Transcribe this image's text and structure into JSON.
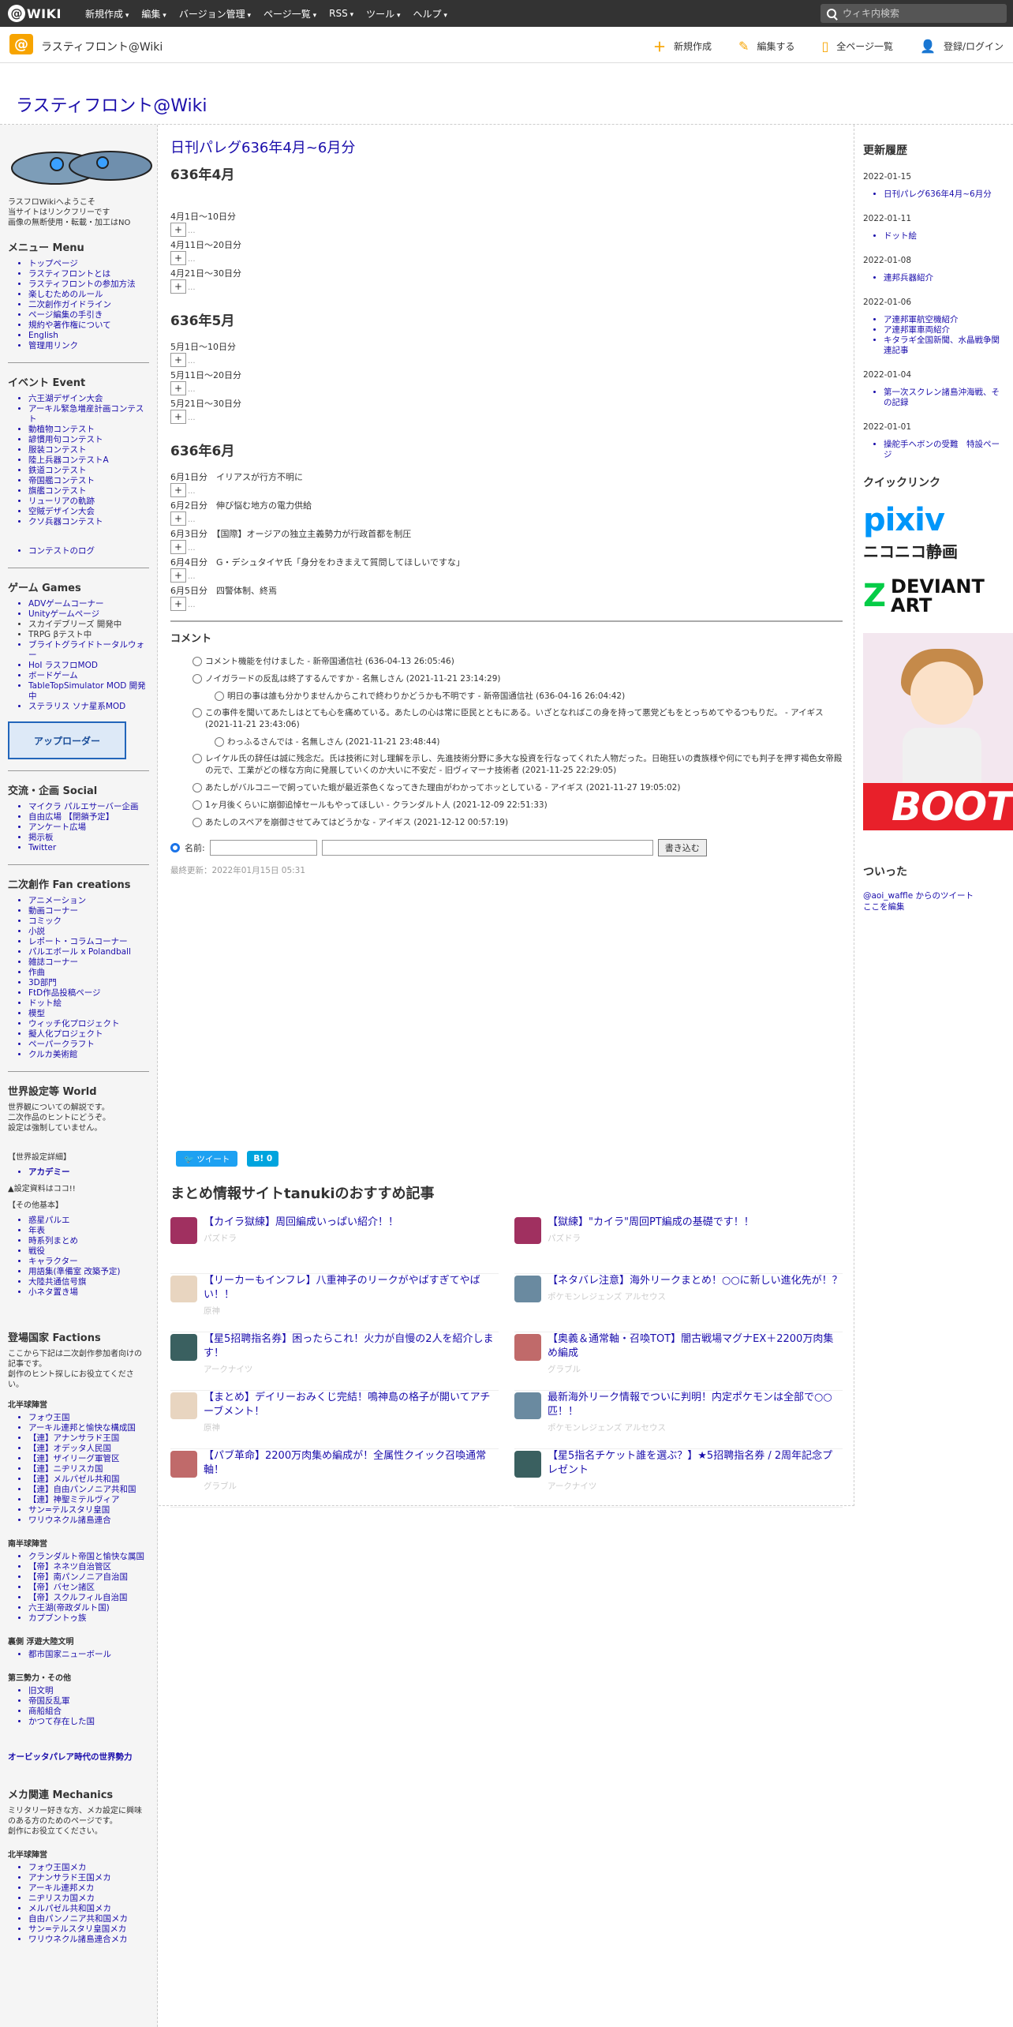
{
  "topbar": {
    "logo": "WIKI",
    "nav": [
      "新規作成",
      "編集",
      "バージョン管理",
      "ページ一覧",
      "RSS",
      "ツール",
      "ヘルプ"
    ],
    "search_placeholder": "ウィキ内検索"
  },
  "header": {
    "site_name": "ラスティフロント@Wiki",
    "actions": [
      "新規作成",
      "編集する",
      "全ページ一覧",
      "登録/ログイン"
    ],
    "page_title": "ラスティフロント@Wiki"
  },
  "left": {
    "intro": [
      "ラスフロWikiへようこそ",
      "当サイトはリンクフリーです",
      "画像の無断使用・転載・加工はNO"
    ],
    "menu_title": "メニュー Menu",
    "menu": [
      "トップページ",
      "ラスティフロントとは",
      "ラスティフロントの参加方法",
      "楽しむためのルール",
      "二次創作ガイドライン",
      "ページ編集の手引き",
      "規約や著作権について",
      "English",
      "管理用リンク"
    ],
    "event_title": "イベント Event",
    "events": [
      "六王湖デザイン大会",
      "アーキル緊急増産計画コンテスト",
      "動植物コンテスト",
      "諺慣用句コンテスト",
      "服装コンテスト",
      "陸上兵器コンテストA",
      "鉄道コンテスト",
      "帝国艦コンテスト",
      "旗艦コンテスト",
      "リューリアの軌跡",
      "空賊デザイン大会",
      "クソ兵器コンテスト"
    ],
    "contest_log": "コンテストのログ",
    "game_title": "ゲーム Games",
    "games": [
      "ADVゲームコーナー",
      "Unityゲームページ",
      "スカイデブリーズ 開発中",
      "TRPG βテスト中",
      "ブライトグライドトータルウォー",
      "HoI ラスフロMOD",
      "ボードゲーム",
      "TableTopSimulator MOD 開発中",
      "ステラリス ソナ星系MOD"
    ],
    "banner": "アップローダー",
    "social_title": "交流・企画 Social",
    "social": [
      "マイクラ パルエサーバー企画",
      "自由広場 【閉鎖予定】",
      "アンケート広場",
      "掲示板",
      "Twitter"
    ],
    "fan_title": "二次創作 Fan creations",
    "fan": [
      "アニメーション",
      "動画コーナー",
      "コミック",
      "小説",
      "レポート・コラムコーナー",
      "パルエボール x Polandball",
      "雑誌コーナー",
      "作曲",
      "3D部門",
      "FtD作品投稿ページ",
      "ドット絵",
      "模型",
      "ウィッチ化プロジェクト",
      "擬人化プロジェクト",
      "ペーパークラフト",
      "クルカ美術館"
    ],
    "world_title": "世界設定等 World",
    "world_desc": [
      "世界観についての解説です。",
      "二次作品のヒントにどうぞ。",
      "設定は強制していません。"
    ],
    "world_detail": "【世界設定詳細】",
    "world_detail_items": [
      "アカデミー"
    ],
    "world_note": "▲設定資料はココ!!",
    "world_other": "【その他基本】",
    "world_items": [
      "惑星パルエ",
      "年表",
      "時系列まとめ",
      "戦役",
      "キャラクター",
      "用語集(準備室 改築予定)",
      "大陸共通信号旗",
      "小ネタ置き場"
    ],
    "factions_title": "登場国家 Factions",
    "factions_desc": [
      "ここから下記は二次創作参加者向けの記事です。",
      "創作のヒント探しにお役立てください。"
    ],
    "north": "北半球陣営",
    "north_items": [
      "フォウ王国",
      "アーキル連邦と愉快な構成国",
      "【連】アナンサラド王国",
      "【連】オデッタ人民国",
      "【連】ザイリーグ軍管区",
      "【連】ニヂリスカ国",
      "【連】メルパゼル共和国",
      "【連】自由パンノニア共和国",
      "【連】神聖ミテルヴィア",
      "サン=テルスタリ皇国",
      "ワリウネクル諸島連合"
    ],
    "south": "南半球陣営",
    "south_items": [
      "クランダルト帝国と愉快な属国",
      "【帝】ネネツ自治管区",
      "【帝】南パンノニア自治国",
      "【帝】バセン諸区",
      "【帝】スクルフィル自治国",
      "六王湖(帝政ダルト国)",
      "カプブントゥ族"
    ],
    "back": "裏側 浮遊大陸文明",
    "back_items": [
      "都市国家ニューボール"
    ],
    "third": "第三勢力・その他",
    "third_items": [
      "旧文明",
      "帝国反乱軍",
      "商船組合",
      "かつて存在した国"
    ],
    "era_link": "オービッタパレア時代の世界勢力",
    "mecha_title": "メカ関連 Mechanics",
    "mecha_desc": [
      "ミリタリー好きな方、メカ設定に興味のある方のためのページです。",
      "創作にお役立てください。"
    ],
    "mecha_north": "北半球陣営",
    "mecha_items": [
      "フォウ王国メカ",
      "アナンサラド王国メカ",
      "アーキル連邦メカ",
      "ニヂリスカ国メカ",
      "メルパゼル共和国メカ",
      "自由パンノニア共和国メカ",
      "サン=テルスタリ皇国メカ",
      "ワリウネクル諸島連合メカ"
    ]
  },
  "main": {
    "title": "日刊パレグ636年4月~6月分",
    "months": [
      {
        "heading": "636年4月",
        "days": [
          {
            "label": "4月1日～10日分",
            "extra": ""
          },
          {
            "label": "4月11日～20日分",
            "extra": ""
          },
          {
            "label": "4月21日～30日分",
            "extra": ""
          }
        ]
      },
      {
        "heading": "636年5月",
        "days": [
          {
            "label": "5月1日～10日分",
            "extra": ""
          },
          {
            "label": "5月11日～20日分",
            "extra": ""
          },
          {
            "label": "5月21日～30日分",
            "extra": ""
          }
        ]
      },
      {
        "heading": "636年6月",
        "days": [
          {
            "label": "6月1日分　イリアスが行方不明に",
            "extra": ""
          },
          {
            "label": "6月2日分　伸び悩む地方の電力供給",
            "extra": ""
          },
          {
            "label": "6月3日分　【国際】オージアの独立主義勢力が行政首都を制圧",
            "extra": ""
          },
          {
            "label": "6月4日分　G・デシュタイヤ氏「身分をわきまえて質問してほしいですな」",
            "extra": ""
          },
          {
            "label": "6月5日分　四警体制、終焉",
            "extra": ""
          }
        ]
      }
    ],
    "toggle": "+",
    "dots": "...",
    "comments_title": "コメント",
    "comments": [
      {
        "indent": 1,
        "text": "コメント機能を付けました - 新帝国通信社 (636-04-13 26:05:46)"
      },
      {
        "indent": 1,
        "text": "ノイガラードの反乱は終了するんですか - 名無しさん (2021-11-21 23:14:29)"
      },
      {
        "indent": 2,
        "text": "明日の事は誰も分かりませんからこれで終わりかどうかも不明です - 新帝国通信社 (636-04-16 26:04:42)"
      },
      {
        "indent": 1,
        "text": "この事件を聞いてあたしはとても心を痛めている。あたしの心は常に臣民とともにある。いざとなればこの身を持って悪党どもをとっちめてやるつもりだ。 - アイギス (2021-11-21 23:43:06)"
      },
      {
        "indent": 2,
        "text": "わっふるさんでは - 名無しさん (2021-11-21 23:48:44)"
      },
      {
        "indent": 1,
        "text": "レイケル氏の辞任は誠に残念だ。氏は技術に対し理解を示し、先進技術分野に多大な投資を行なってくれた人物だった。日砲狂いの貴族様や何にでも判子を押す褐色女帝殿の元で、工業がどの様な方向に発展していくのか大いに不安だ - 旧ヴィマーナ技術者 (2021-11-25 22:29:05)"
      },
      {
        "indent": 1,
        "text": "あたしがバルコニーで飼っていた蛾が最近茶色くなってきた理由がわかってホッとしている - アイギス (2021-11-27 19:05:02)"
      },
      {
        "indent": 1,
        "text": "1ヶ月後くらいに崩御追悼セールもやってほしい - クランダルト人 (2021-12-09 22:51:33)"
      },
      {
        "indent": 1,
        "text": "あたしのスペアを崩御させてみてはどうかな - アイギス (2021-12-12 00:57:19)"
      }
    ],
    "form_name": "名前:",
    "form_submit": "書き込む",
    "last_updated": "最終更新：2022年01月15日 05:31",
    "share_tweet": "ツイート",
    "share_hatena": "B! 0",
    "rec_title": "まとめ情報サイトtanukiのおすすめ記事",
    "recs": [
      {
        "title": "【カイラ獄練】周回編成いっぱい紹介！！",
        "src": "パズドラ",
        "color": "#a03060"
      },
      {
        "title": "【獄練】\"カイラ\"周回PT編成の基礎です！！",
        "src": "パズドラ",
        "color": "#a03060"
      },
      {
        "title": "【リーカーもインフレ】八重神子のリークがやばすぎてやばい！！",
        "src": "原神",
        "color": "#e8d5c0"
      },
      {
        "title": "【ネタバレ注意】海外リークまとめ！○○に新しい進化先が！？",
        "src": "ポケモンレジェンズ アルセウス",
        "color": "#6a8aa0"
      },
      {
        "title": "【星5招聘指名券】困ったらこれ！火力が自慢の2人を紹介します！",
        "src": "アークナイツ",
        "color": "#3a6060"
      },
      {
        "title": "【奥義＆通常軸・召喚TOT】闇古戦場マグナEX＋2200万肉集め編成",
        "src": "グラブル",
        "color": "#c06a6a"
      },
      {
        "title": "【まとめ】デイリーおみくじ完結！鳴神島の格子が開いてアチーブメント！",
        "src": "原神",
        "color": "#e8d5c0"
      },
      {
        "title": "最新海外リーク情報でついに判明！内定ポケモンは全部で○○匹！！",
        "src": "ポケモンレジェンズ アルセウス",
        "color": "#6a8aa0"
      },
      {
        "title": "【パブ革命】2200万肉集め編成が！全属性クイック召喚通常軸！",
        "src": "グラブル",
        "color": "#c06a6a"
      },
      {
        "title": "【星5指名チケット誰を選ぶ？】★5招聘指名券 / 2周年記念プレゼント",
        "src": "アークナイツ",
        "color": "#3a6060"
      }
    ]
  },
  "right": {
    "history_title": "更新履歴",
    "history": [
      {
        "date": "2022-01-15",
        "items": [
          "日刊パレグ636年4月~6月分"
        ]
      },
      {
        "date": "2022-01-11",
        "items": [
          "ドット絵"
        ]
      },
      {
        "date": "2022-01-08",
        "items": [
          "連邦兵器紹介"
        ]
      },
      {
        "date": "2022-01-06",
        "items": [
          "ア連邦軍航空機紹介",
          "ア連邦軍車両紹介",
          "キタラギ全国新聞、水晶戦争関連記事"
        ]
      },
      {
        "date": "2022-01-04",
        "items": [
          "第一次スクレン諸島沖海戦、その記録"
        ]
      },
      {
        "date": "2022-01-01",
        "items": [
          "操舵手ヘボンの受難　特設ページ"
        ]
      }
    ],
    "quick_title": "クイックリンク",
    "quick": {
      "pixiv": "pixiv",
      "nico": "ニコニコ静画",
      "deviant": "DEVIANT ART"
    },
    "boot": "BOOT",
    "twitter_title": "ついった",
    "twitter_link": "@aoi_waffle からのツイート",
    "twitter_edit": "ここを編集"
  }
}
